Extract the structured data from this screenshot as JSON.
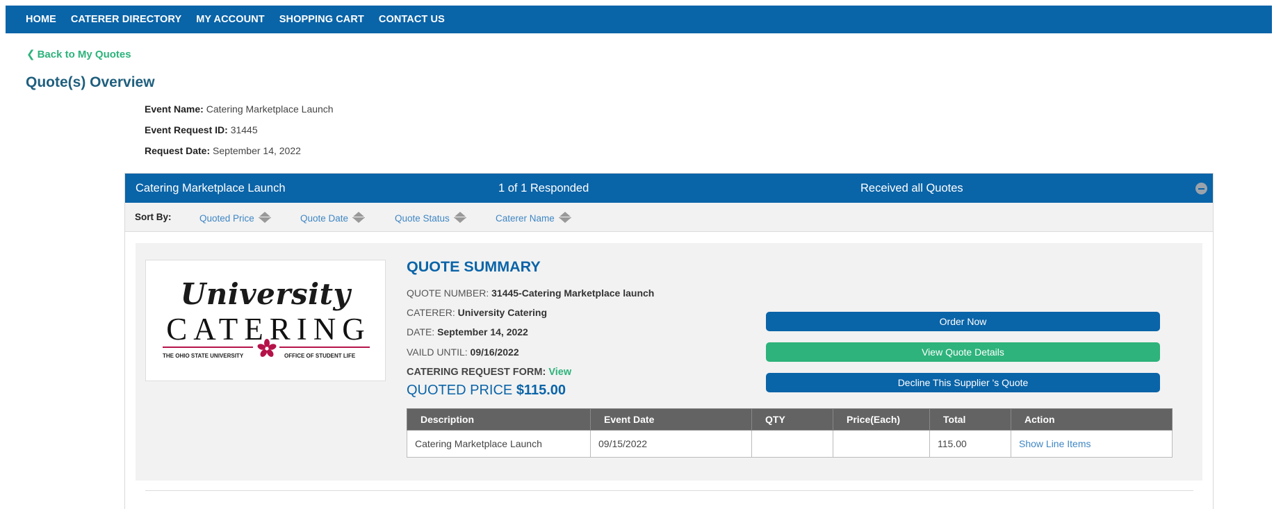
{
  "nav": {
    "items": [
      "HOME",
      "CATERER DIRECTORY",
      "MY ACCOUNT",
      "SHOPPING CART",
      "CONTACT US"
    ]
  },
  "back_link": "Back to My Quotes",
  "page_title": "Quote(s) Overview",
  "event": {
    "name_label": "Event Name:",
    "name": "Catering Marketplace Launch",
    "request_id_label": "Event Request ID:",
    "request_id": "31445",
    "request_date_label": "Request Date:",
    "request_date": "September 14, 2022"
  },
  "panel": {
    "event_name": "Catering Marketplace Launch",
    "responded": "1 of 1 Responded",
    "status": "Received all Quotes"
  },
  "sort": {
    "label": "Sort By:",
    "options": [
      "Quoted Price",
      "Quote Date",
      "Quote Status",
      "Caterer Name"
    ]
  },
  "logo": {
    "script_text": "University",
    "block_text": "CATERING",
    "left_text": "THE OHIO STATE UNIVERSITY",
    "right_text": "OFFICE OF STUDENT LIFE",
    "accent_color": "#b5124a"
  },
  "summary": {
    "title": "QUOTE SUMMARY",
    "quote_number_label": "QUOTE NUMBER:",
    "quote_number": "31445-Catering Marketplace launch",
    "caterer_label": "CATERER:",
    "caterer": "University Catering",
    "date_label": "DATE:",
    "date": "September 14, 2022",
    "valid_until_label": "VAILD UNTIL:",
    "valid_until": "09/16/2022",
    "form_label": "CATERING REQUEST FORM:",
    "form_link": "View",
    "price_label": "QUOTED PRICE",
    "price": "$115.00"
  },
  "buttons": {
    "order": "Order Now",
    "view_details": "View Quote Details",
    "decline": "Decline This Supplier 's Quote"
  },
  "table": {
    "headers": [
      "Description",
      "Event Date",
      "QTY",
      "Price(Each)",
      "Total",
      "Action"
    ],
    "rows": [
      [
        "Catering Marketplace Launch",
        "09/15/2022",
        "",
        "",
        "115.00",
        "Show Line Items"
      ]
    ]
  },
  "colors": {
    "primary": "#0a64a8",
    "success": "#2db37b",
    "table_header": "#636363"
  }
}
